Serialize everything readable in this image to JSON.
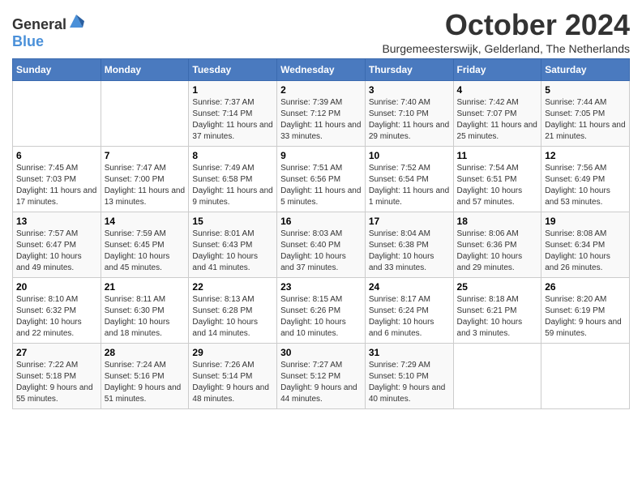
{
  "header": {
    "logo_general": "General",
    "logo_blue": "Blue",
    "month": "October 2024",
    "location": "Burgemeesterswijk, Gelderland, The Netherlands"
  },
  "days_of_week": [
    "Sunday",
    "Monday",
    "Tuesday",
    "Wednesday",
    "Thursday",
    "Friday",
    "Saturday"
  ],
  "weeks": [
    [
      {
        "day": "",
        "info": ""
      },
      {
        "day": "",
        "info": ""
      },
      {
        "day": "1",
        "sunrise": "7:37 AM",
        "sunset": "7:14 PM",
        "daylight": "11 hours and 37 minutes."
      },
      {
        "day": "2",
        "sunrise": "7:39 AM",
        "sunset": "7:12 PM",
        "daylight": "11 hours and 33 minutes."
      },
      {
        "day": "3",
        "sunrise": "7:40 AM",
        "sunset": "7:10 PM",
        "daylight": "11 hours and 29 minutes."
      },
      {
        "day": "4",
        "sunrise": "7:42 AM",
        "sunset": "7:07 PM",
        "daylight": "11 hours and 25 minutes."
      },
      {
        "day": "5",
        "sunrise": "7:44 AM",
        "sunset": "7:05 PM",
        "daylight": "11 hours and 21 minutes."
      }
    ],
    [
      {
        "day": "6",
        "sunrise": "7:45 AM",
        "sunset": "7:03 PM",
        "daylight": "11 hours and 17 minutes."
      },
      {
        "day": "7",
        "sunrise": "7:47 AM",
        "sunset": "7:00 PM",
        "daylight": "11 hours and 13 minutes."
      },
      {
        "day": "8",
        "sunrise": "7:49 AM",
        "sunset": "6:58 PM",
        "daylight": "11 hours and 9 minutes."
      },
      {
        "day": "9",
        "sunrise": "7:51 AM",
        "sunset": "6:56 PM",
        "daylight": "11 hours and 5 minutes."
      },
      {
        "day": "10",
        "sunrise": "7:52 AM",
        "sunset": "6:54 PM",
        "daylight": "11 hours and 1 minute."
      },
      {
        "day": "11",
        "sunrise": "7:54 AM",
        "sunset": "6:51 PM",
        "daylight": "10 hours and 57 minutes."
      },
      {
        "day": "12",
        "sunrise": "7:56 AM",
        "sunset": "6:49 PM",
        "daylight": "10 hours and 53 minutes."
      }
    ],
    [
      {
        "day": "13",
        "sunrise": "7:57 AM",
        "sunset": "6:47 PM",
        "daylight": "10 hours and 49 minutes."
      },
      {
        "day": "14",
        "sunrise": "7:59 AM",
        "sunset": "6:45 PM",
        "daylight": "10 hours and 45 minutes."
      },
      {
        "day": "15",
        "sunrise": "8:01 AM",
        "sunset": "6:43 PM",
        "daylight": "10 hours and 41 minutes."
      },
      {
        "day": "16",
        "sunrise": "8:03 AM",
        "sunset": "6:40 PM",
        "daylight": "10 hours and 37 minutes."
      },
      {
        "day": "17",
        "sunrise": "8:04 AM",
        "sunset": "6:38 PM",
        "daylight": "10 hours and 33 minutes."
      },
      {
        "day": "18",
        "sunrise": "8:06 AM",
        "sunset": "6:36 PM",
        "daylight": "10 hours and 29 minutes."
      },
      {
        "day": "19",
        "sunrise": "8:08 AM",
        "sunset": "6:34 PM",
        "daylight": "10 hours and 26 minutes."
      }
    ],
    [
      {
        "day": "20",
        "sunrise": "8:10 AM",
        "sunset": "6:32 PM",
        "daylight": "10 hours and 22 minutes."
      },
      {
        "day": "21",
        "sunrise": "8:11 AM",
        "sunset": "6:30 PM",
        "daylight": "10 hours and 18 minutes."
      },
      {
        "day": "22",
        "sunrise": "8:13 AM",
        "sunset": "6:28 PM",
        "daylight": "10 hours and 14 minutes."
      },
      {
        "day": "23",
        "sunrise": "8:15 AM",
        "sunset": "6:26 PM",
        "daylight": "10 hours and 10 minutes."
      },
      {
        "day": "24",
        "sunrise": "8:17 AM",
        "sunset": "6:24 PM",
        "daylight": "10 hours and 6 minutes."
      },
      {
        "day": "25",
        "sunrise": "8:18 AM",
        "sunset": "6:21 PM",
        "daylight": "10 hours and 3 minutes."
      },
      {
        "day": "26",
        "sunrise": "8:20 AM",
        "sunset": "6:19 PM",
        "daylight": "9 hours and 59 minutes."
      }
    ],
    [
      {
        "day": "27",
        "sunrise": "7:22 AM",
        "sunset": "5:18 PM",
        "daylight": "9 hours and 55 minutes."
      },
      {
        "day": "28",
        "sunrise": "7:24 AM",
        "sunset": "5:16 PM",
        "daylight": "9 hours and 51 minutes."
      },
      {
        "day": "29",
        "sunrise": "7:26 AM",
        "sunset": "5:14 PM",
        "daylight": "9 hours and 48 minutes."
      },
      {
        "day": "30",
        "sunrise": "7:27 AM",
        "sunset": "5:12 PM",
        "daylight": "9 hours and 44 minutes."
      },
      {
        "day": "31",
        "sunrise": "7:29 AM",
        "sunset": "5:10 PM",
        "daylight": "9 hours and 40 minutes."
      },
      {
        "day": "",
        "info": ""
      },
      {
        "day": "",
        "info": ""
      }
    ]
  ],
  "labels": {
    "sunrise": "Sunrise:",
    "sunset": "Sunset:",
    "daylight": "Daylight:"
  }
}
